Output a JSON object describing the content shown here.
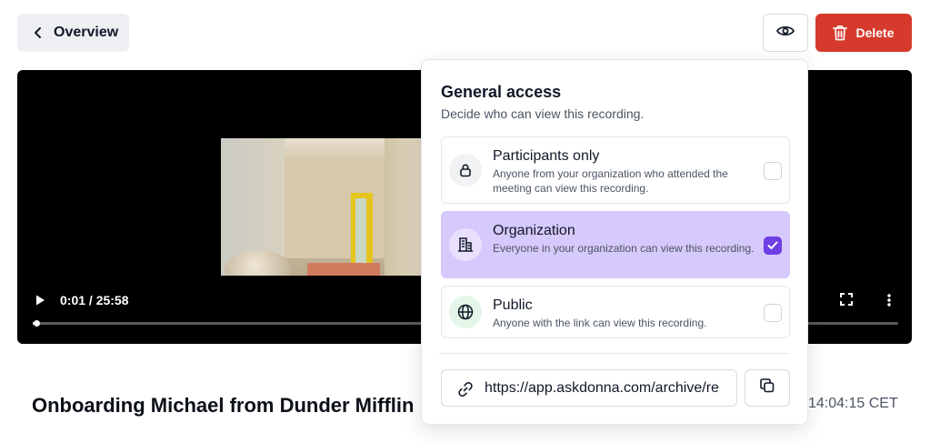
{
  "header": {
    "back_label": "Overview",
    "delete_label": "Delete"
  },
  "player": {
    "time_display": "0:01 / 25:58",
    "progress_fraction": 0.001
  },
  "recording": {
    "title": "Onboarding Michael from Dunder Mifflin",
    "timestamp": "14:04:15 CET"
  },
  "access_popover": {
    "title": "General access",
    "subtitle": "Decide who can view this recording.",
    "options": [
      {
        "label": "Participants only",
        "description": "Anyone from your organization who attended the meeting can view this recording.",
        "checked": false,
        "icon": "lock-icon"
      },
      {
        "label": "Organization",
        "description": "Everyone in your organization can view this recording.",
        "checked": true,
        "icon": "building-icon"
      },
      {
        "label": "Public",
        "description": "Anyone with the link can view this recording.",
        "checked": false,
        "icon": "globe-icon"
      }
    ],
    "share_link": "https://app.askdonna.com/archive/re"
  },
  "colors": {
    "delete_bg": "#d53a2c",
    "selected_option_bg": "#d6c9fb",
    "checkbox_checked": "#6d3fe4"
  }
}
